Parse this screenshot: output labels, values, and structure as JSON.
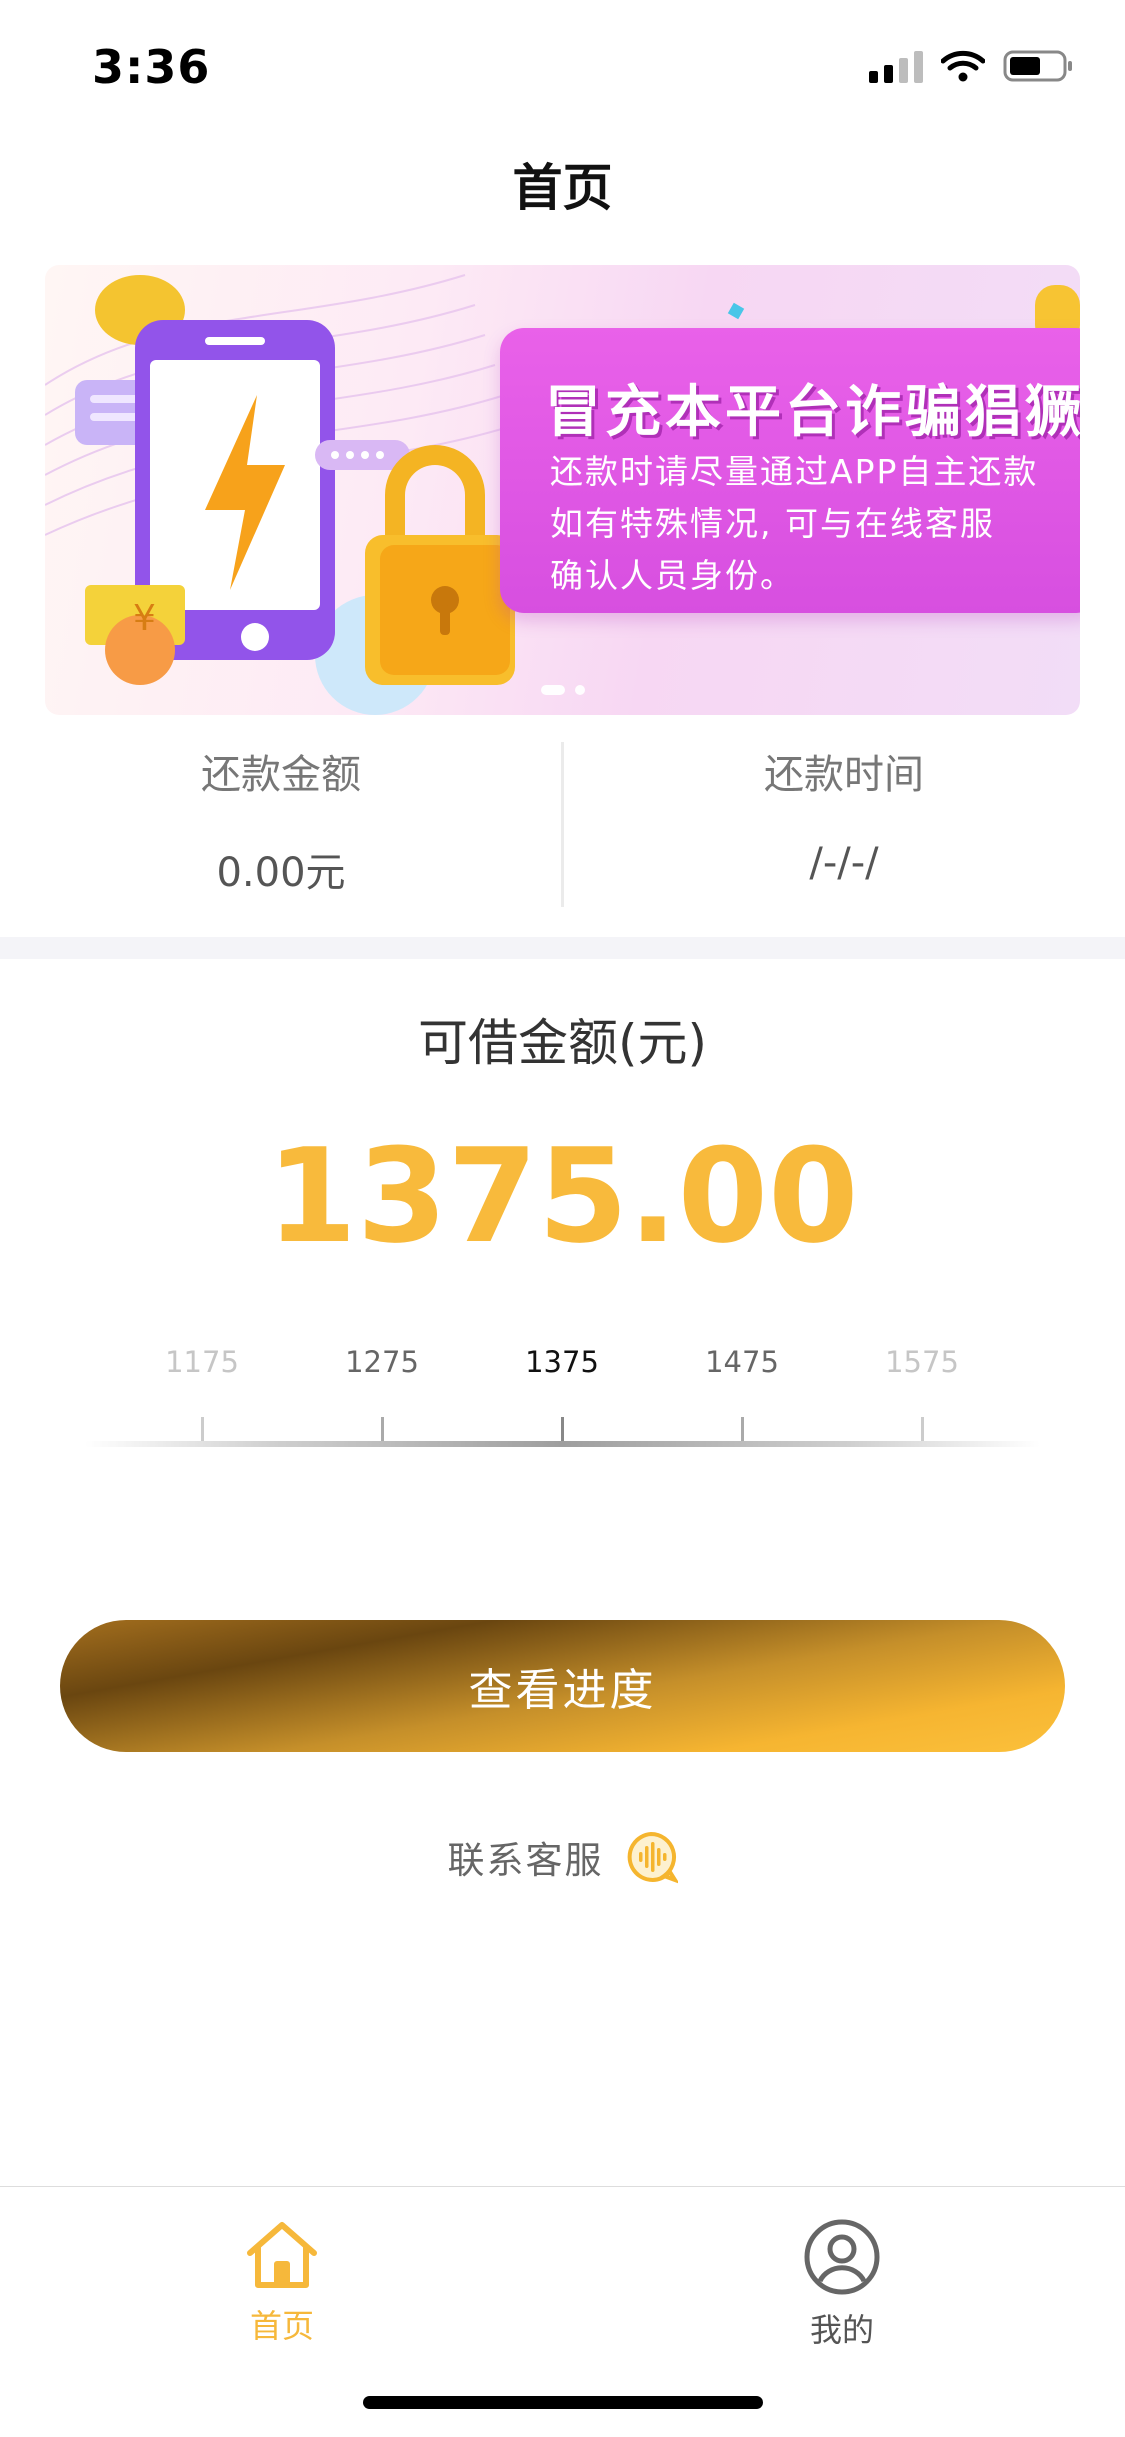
{
  "status_bar": {
    "time": "3:36"
  },
  "nav": {
    "title": "首页"
  },
  "banner": {
    "headline": "冒充本平台诈骗猖獗",
    "lines": [
      "还款时请尽量通过APP自主还款",
      "如有特殊情况, 可与在线客服",
      "确认人员身份。"
    ],
    "currency_symbol": "¥"
  },
  "repayment": {
    "amount_label": "还款金额",
    "amount_value": "0.00元",
    "time_label": "还款时间",
    "time_value": "/-/-/"
  },
  "loan": {
    "label": "可借金额(元)",
    "amount": "1375.00",
    "ruler_ticks": [
      "1175",
      "1275",
      "1375",
      "1475",
      "1575"
    ],
    "selected": "1375"
  },
  "actions": {
    "check_progress": "查看进度",
    "contact_service": "联系客服"
  },
  "tabbar": {
    "home": "首页",
    "mine": "我的"
  },
  "colors": {
    "accent": "#f8ba3c",
    "tab_active": "#f6b83b",
    "tab_inactive": "#555555"
  }
}
